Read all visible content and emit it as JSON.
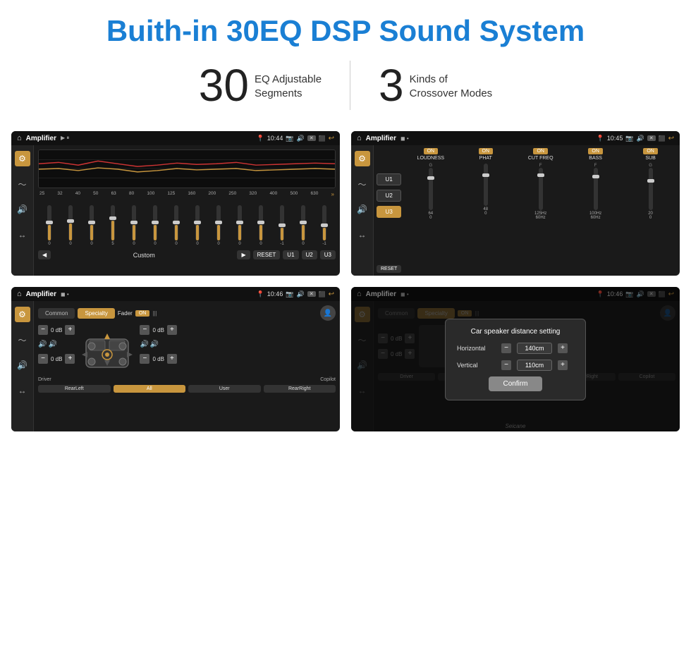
{
  "header": {
    "title": "Buith-in 30EQ DSP Sound System"
  },
  "stats": [
    {
      "number": "30",
      "label": "EQ Adjustable\nSegments"
    },
    {
      "number": "3",
      "label": "Kinds of\nCrossover Modes"
    }
  ],
  "screens": [
    {
      "id": "eq-screen",
      "app_name": "Amplifier",
      "time": "10:44",
      "type": "eq",
      "frequencies": [
        "25",
        "32",
        "40",
        "50",
        "63",
        "80",
        "100",
        "125",
        "160",
        "200",
        "250",
        "320",
        "400",
        "500",
        "630"
      ],
      "slider_values": [
        "0",
        "0",
        "0",
        "5",
        "0",
        "0",
        "0",
        "0",
        "0",
        "0",
        "0",
        "-1",
        "0",
        "-1"
      ],
      "preset_label": "Custom",
      "buttons": [
        "RESET",
        "U1",
        "U2",
        "U3"
      ]
    },
    {
      "id": "crossover-screen",
      "app_name": "Amplifier",
      "time": "10:45",
      "type": "crossover",
      "presets": [
        "U1",
        "U2",
        "U3"
      ],
      "active_preset": "U3",
      "channels": [
        {
          "name": "LOUDNESS",
          "on": true
        },
        {
          "name": "PHAT",
          "on": true
        },
        {
          "name": "CUT FREQ",
          "on": true
        },
        {
          "name": "BASS",
          "on": true
        },
        {
          "name": "SUB",
          "on": true
        }
      ],
      "reset_label": "RESET"
    },
    {
      "id": "specialty-screen",
      "app_name": "Amplifier",
      "time": "10:46",
      "type": "specialty",
      "tabs": [
        "Common",
        "Specialty"
      ],
      "active_tab": "Specialty",
      "fader_label": "Fader",
      "fader_on": true,
      "volumes": [
        {
          "label": "0 dB"
        },
        {
          "label": "0 dB"
        },
        {
          "label": "0 dB"
        },
        {
          "label": "0 dB"
        }
      ],
      "speaker_positions": [
        "Driver",
        "RearLeft",
        "All",
        "User",
        "RearRight",
        "Copilot"
      ],
      "active_speaker": "All"
    },
    {
      "id": "distance-screen",
      "app_name": "Amplifier",
      "time": "10:46",
      "type": "distance",
      "dialog": {
        "title": "Car speaker distance setting",
        "horizontal_label": "Horizontal",
        "horizontal_value": "140cm",
        "vertical_label": "Vertical",
        "vertical_value": "110cm",
        "confirm_label": "Confirm"
      },
      "tabs": [
        "Common",
        "Specialty"
      ],
      "active_tab": "Specialty"
    }
  ],
  "watermark": "Seicane"
}
